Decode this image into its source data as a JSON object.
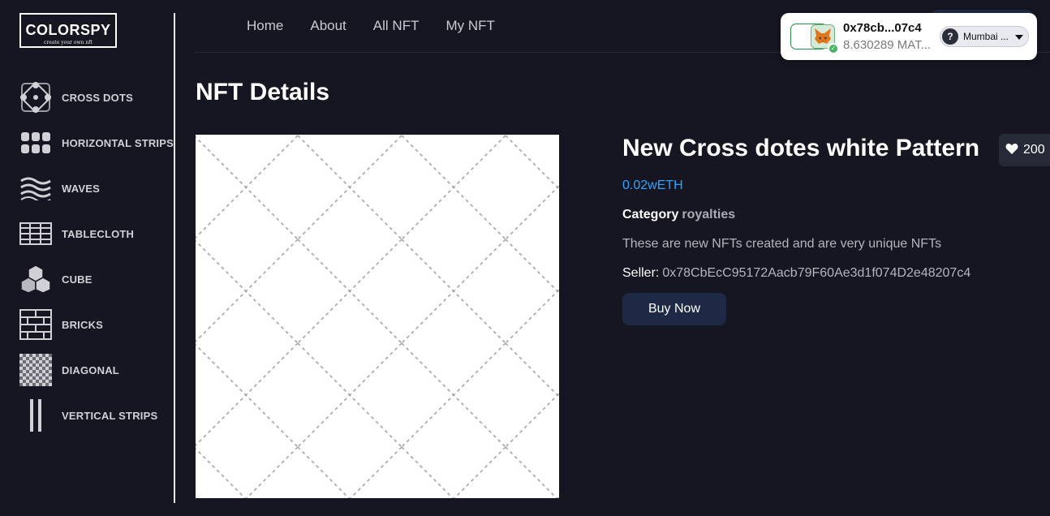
{
  "brand": {
    "name": "COLORSPY",
    "tagline": "create your own nft"
  },
  "sidebar": {
    "items": [
      {
        "label": "CROSS DOTS",
        "icon": "cross-dots-icon"
      },
      {
        "label": "HORIZONTAL STRIPS",
        "icon": "horizontal-strips-icon"
      },
      {
        "label": "WAVES",
        "icon": "waves-icon"
      },
      {
        "label": "TABLECLOTH",
        "icon": "tablecloth-icon"
      },
      {
        "label": "CUBE",
        "icon": "cube-icon"
      },
      {
        "label": "BRICKS",
        "icon": "bricks-icon"
      },
      {
        "label": "DIAGONAL",
        "icon": "diagonal-icon"
      },
      {
        "label": "VERTICAL STRIPS",
        "icon": "vertical-strips-icon"
      }
    ]
  },
  "nav": {
    "links": [
      "Home",
      "About",
      "All NFT",
      "My NFT"
    ]
  },
  "wallet": {
    "address": "0x78cb...07c4",
    "balance": "8.630289 MAT...",
    "network": "Mumbai ...",
    "network_icon": "?"
  },
  "page": {
    "title": "NFT Details"
  },
  "nft": {
    "name": "New Cross dotes white Pattern",
    "price": "0.02wETH",
    "category_label": "Category",
    "category": "royalties",
    "description": "These are new NFTs created and are very unique NFTs",
    "seller_label": "Seller:",
    "seller": "0x78CbEcC95172Aacb79F60Ae3d1f074D2e48207c4",
    "likes": "200",
    "buy_label": "Buy Now"
  },
  "colors": {
    "background": "#161622",
    "accent_price": "#2aa3ff",
    "button": "#1e2a45",
    "wallet_green": "#2a8f47"
  }
}
